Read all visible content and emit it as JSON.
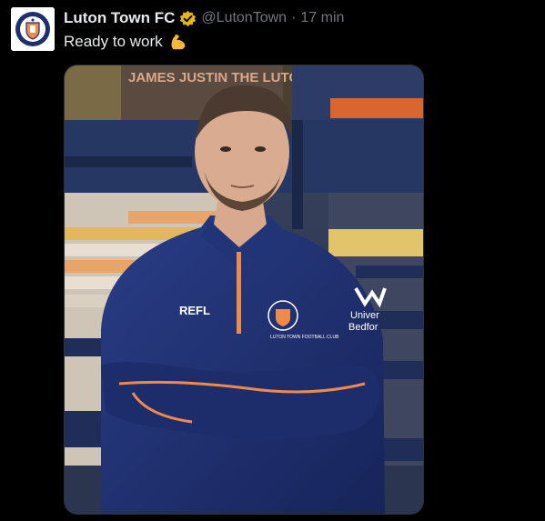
{
  "tweet": {
    "display_name": "Luton Town FC",
    "handle": "@LutonTown",
    "separator": "·",
    "time": "17 min",
    "text": "Ready to work",
    "emoji_icon": "flexed-biceps-icon",
    "verified_icon": "verified-badge-icon",
    "avatar_icon": "luton-town-crest-icon"
  },
  "media": {
    "stand_banner_text": "JAMES JUSTIN THE LUTON",
    "shirt_sponsor_left": "REFL",
    "shirt_sponsor_right_line1": "Univer",
    "shirt_sponsor_right_line2": "Bedfor",
    "crest_text": "LUTON TOWN FOOTBALL CLUB"
  },
  "colors": {
    "background": "#000000",
    "name_text": "#e7e9ea",
    "muted_text": "#71767b",
    "verified_gold": "#e2b719",
    "shirt_navy": "#1e2f6e",
    "shirt_orange": "#f08a4b"
  }
}
